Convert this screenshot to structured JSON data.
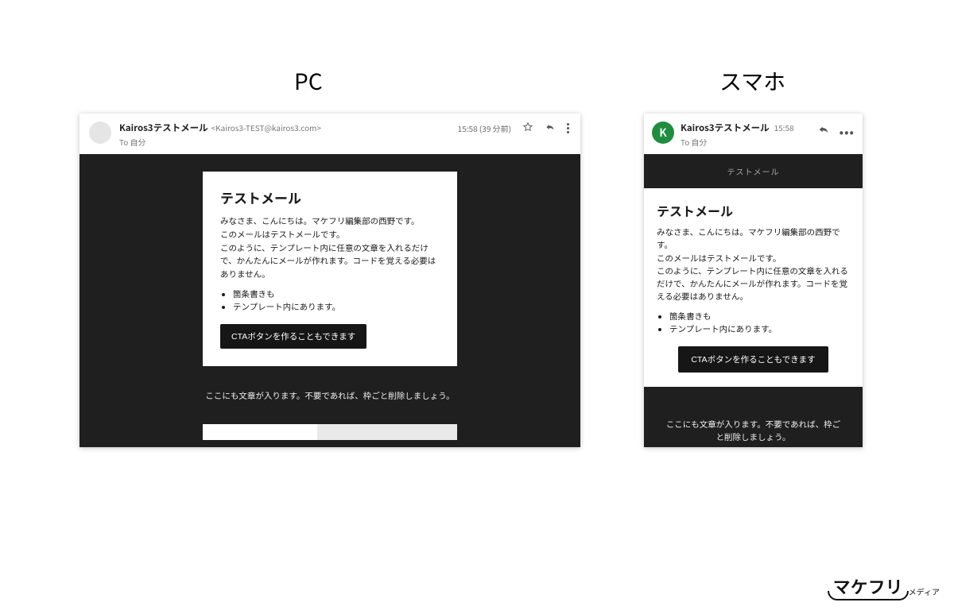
{
  "headings": {
    "pc": "PC",
    "sp": "スマホ"
  },
  "pc": {
    "from_name": "Kairos3テストメール",
    "from_addr": "<Kairos3-TEST@kairos3.com>",
    "to_line": "To 自分",
    "time": "15:58 (39 分前)",
    "title": "テストメール",
    "p1": "みなさま、こんにちは。マケフリ編集部の西野です。",
    "p2": "このメールはテストメールです。",
    "p3": "このように、テンプレート内に任意の文章を入れるだけで、かんたんにメールが作れます。コードを覚える必要はありません。",
    "li1": "箇条書きも",
    "li2": "テンプレート内にあります。",
    "cta": "CTAボタンを作ることもできます",
    "footer": "ここにも文章が入ります。不要であれば、枠ごと削除しましょう。"
  },
  "sp": {
    "avatar_initial": "K",
    "from_name": "Kairos3テストメール",
    "time": "15:58",
    "to_line": "To 自分",
    "banner": "テストメール",
    "title": "テストメール",
    "p1": "みなさま、こんにちは。マケフリ編集部の西野です。",
    "p2": "このメールはテストメールです。",
    "p3": "このように、テンプレート内に任意の文章を入れるだけで、かんたんにメールが作れます。コードを覚える必要はありません。",
    "li1": "箇条書きも",
    "li2": "テンプレート内にあります。",
    "cta": "CTAボタンを作ることもできます",
    "footer": "ここにも文章が入ります。不要であれば、枠ごと削除しましょう。"
  },
  "watermark": {
    "main": "マケフリ",
    "sub": "メディア"
  }
}
